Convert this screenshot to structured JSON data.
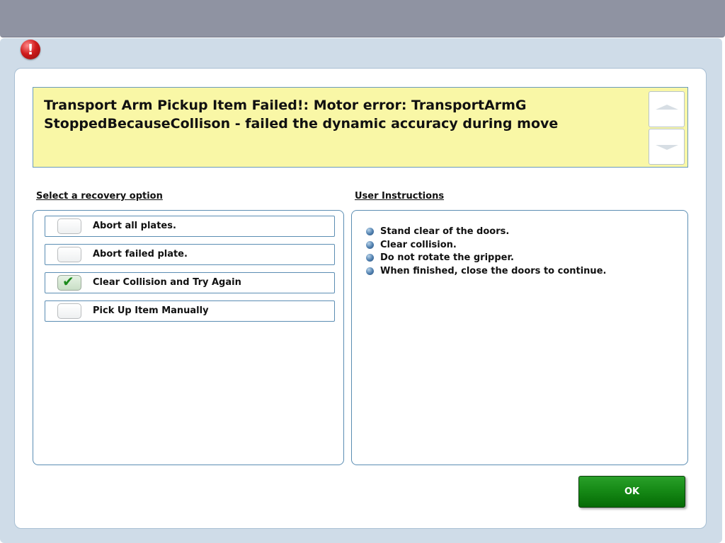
{
  "dialog": {
    "icon": "error-icon",
    "icon_glyph": "!",
    "message": "Transport Arm Pickup Item Failed!: Motor error:  TransportArmG StoppedBecauseCollison - failed the dynamic accuracy during move",
    "colors": {
      "message_bg": "#f9f7a6",
      "ok_green": "#168a16",
      "error_red": "#d01c1c"
    }
  },
  "recovery": {
    "label": "Select a recovery option",
    "options": [
      {
        "label": "Abort all plates.",
        "checked": false
      },
      {
        "label": "Abort failed plate.",
        "checked": false
      },
      {
        "label": "Clear Collision and Try Again",
        "checked": true,
        "check_glyph": "✔"
      },
      {
        "label": "Pick Up Item Manually",
        "checked": false
      }
    ]
  },
  "instructions": {
    "label": "User Instructions",
    "items": [
      "Stand clear of the doors.",
      "Clear collision.",
      "Do not rotate the gripper.",
      "When finished, close the doors to continue."
    ]
  },
  "ok_button": {
    "label": "OK"
  }
}
